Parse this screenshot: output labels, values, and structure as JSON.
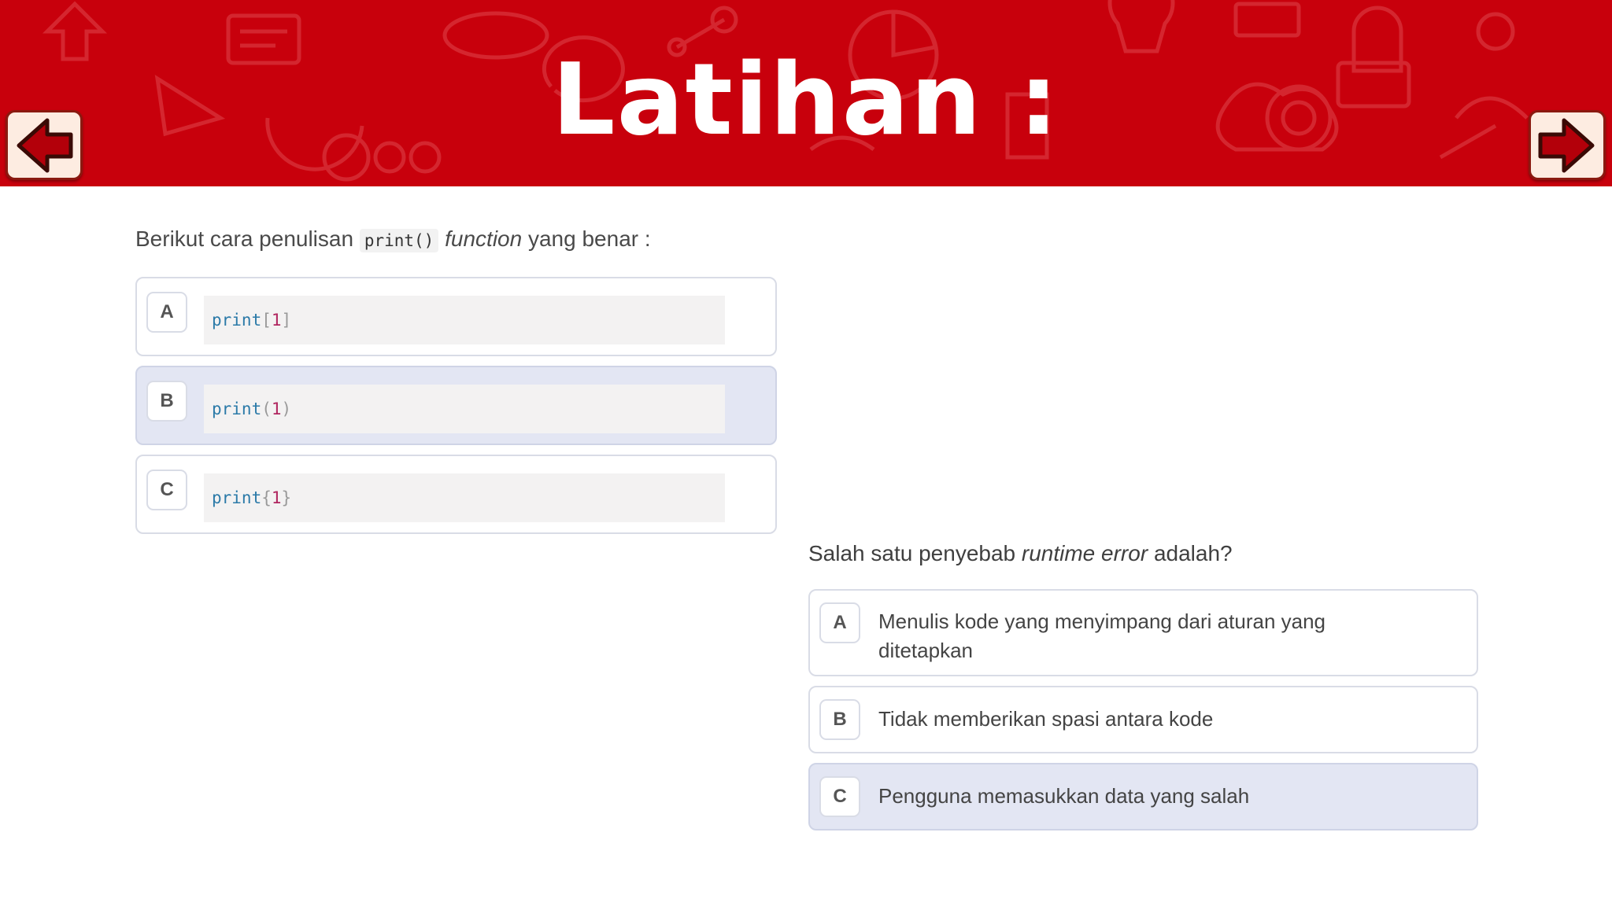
{
  "header": {
    "title": "Latihan :",
    "background_color": "#c8000c",
    "prev_icon": "arrow-left-icon",
    "next_icon": "arrow-right-icon"
  },
  "question1": {
    "text_before": "Berikut cara penulisan",
    "code": "print()",
    "emphasis": "function",
    "text_after": "yang benar :",
    "selected": "B",
    "options": [
      {
        "letter": "A",
        "fn": "print",
        "open": "[",
        "arg": "1",
        "close": "]"
      },
      {
        "letter": "B",
        "fn": "print",
        "open": "(",
        "arg": "1",
        "close": ")"
      },
      {
        "letter": "C",
        "fn": "print",
        "open": "{",
        "arg": "1",
        "close": "}"
      }
    ]
  },
  "question2": {
    "text_before": "Salah satu penyebab",
    "emphasis": "runtime error",
    "text_after": "adalah?",
    "selected": "C",
    "options": [
      {
        "letter": "A",
        "line1": "Menulis kode yang menyimpang dari aturan yang",
        "line2": "ditetapkan"
      },
      {
        "letter": "B",
        "text": "Tidak memberikan spasi antara kode"
      },
      {
        "letter": "C",
        "text": "Pengguna memasukkan data yang salah"
      }
    ]
  },
  "colors": {
    "selected_option_bg": "#e3e6f3",
    "code_function": "#2b7aa8",
    "code_number": "#b0255f"
  }
}
